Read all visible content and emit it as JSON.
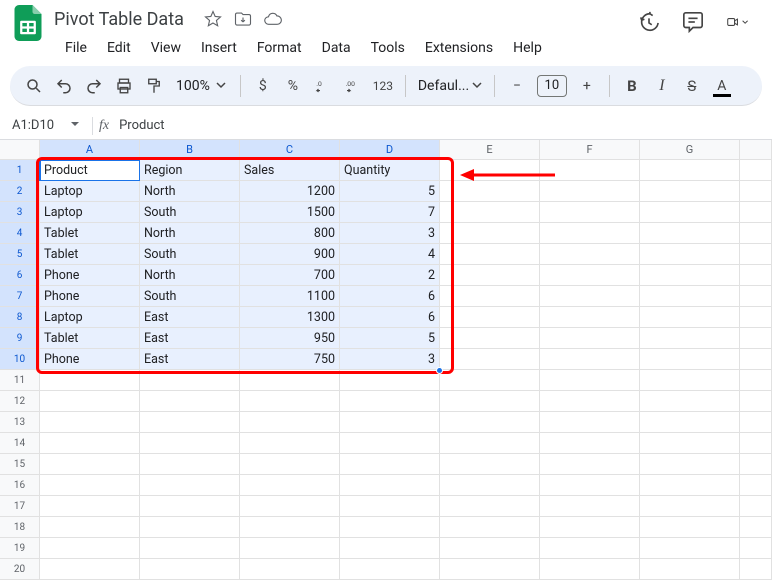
{
  "doc": {
    "title": "Pivot Table Data"
  },
  "menu": {
    "file": "File",
    "edit": "Edit",
    "view": "View",
    "insert": "Insert",
    "format": "Format",
    "data": "Data",
    "tools": "Tools",
    "extensions": "Extensions",
    "help": "Help"
  },
  "toolbar": {
    "zoom": "100%",
    "currency": "$",
    "percent": "%",
    "fmt123": "123",
    "font_name": "Defaul...",
    "minus": "−",
    "plus": "+",
    "font_size": "10",
    "bold": "B",
    "italic": "I",
    "strike": "S",
    "textcolor": "A"
  },
  "namebox": {
    "ref": "A1:D10"
  },
  "fx": {
    "label": "fx",
    "value": "Product"
  },
  "columns": [
    "A",
    "B",
    "C",
    "D",
    "E",
    "F",
    "G"
  ],
  "selected_cols": 4,
  "rows": [
    {
      "n": 1,
      "sel": true,
      "cells": [
        {
          "v": "Product",
          "active": true
        },
        {
          "v": "Region"
        },
        {
          "v": "Sales"
        },
        {
          "v": "Quantity"
        },
        {
          "v": ""
        },
        {
          "v": ""
        },
        {
          "v": ""
        }
      ]
    },
    {
      "n": 2,
      "sel": true,
      "cells": [
        {
          "v": "Laptop"
        },
        {
          "v": "North"
        },
        {
          "v": "1200",
          "num": true
        },
        {
          "v": "5",
          "num": true
        },
        {
          "v": ""
        },
        {
          "v": ""
        },
        {
          "v": ""
        }
      ]
    },
    {
      "n": 3,
      "sel": true,
      "cells": [
        {
          "v": "Laptop"
        },
        {
          "v": "South"
        },
        {
          "v": "1500",
          "num": true
        },
        {
          "v": "7",
          "num": true
        },
        {
          "v": ""
        },
        {
          "v": ""
        },
        {
          "v": ""
        }
      ]
    },
    {
      "n": 4,
      "sel": true,
      "cells": [
        {
          "v": "Tablet"
        },
        {
          "v": "North"
        },
        {
          "v": "800",
          "num": true
        },
        {
          "v": "3",
          "num": true
        },
        {
          "v": ""
        },
        {
          "v": ""
        },
        {
          "v": ""
        }
      ]
    },
    {
      "n": 5,
      "sel": true,
      "cells": [
        {
          "v": "Tablet"
        },
        {
          "v": "South"
        },
        {
          "v": "900",
          "num": true
        },
        {
          "v": "4",
          "num": true
        },
        {
          "v": ""
        },
        {
          "v": ""
        },
        {
          "v": ""
        }
      ]
    },
    {
      "n": 6,
      "sel": true,
      "cells": [
        {
          "v": "Phone"
        },
        {
          "v": "North"
        },
        {
          "v": "700",
          "num": true
        },
        {
          "v": "2",
          "num": true
        },
        {
          "v": ""
        },
        {
          "v": ""
        },
        {
          "v": ""
        }
      ]
    },
    {
      "n": 7,
      "sel": true,
      "cells": [
        {
          "v": "Phone"
        },
        {
          "v": "South"
        },
        {
          "v": "1100",
          "num": true
        },
        {
          "v": "6",
          "num": true
        },
        {
          "v": ""
        },
        {
          "v": ""
        },
        {
          "v": ""
        }
      ]
    },
    {
      "n": 8,
      "sel": true,
      "cells": [
        {
          "v": "Laptop"
        },
        {
          "v": "East"
        },
        {
          "v": "1300",
          "num": true
        },
        {
          "v": "6",
          "num": true
        },
        {
          "v": ""
        },
        {
          "v": ""
        },
        {
          "v": ""
        }
      ]
    },
    {
      "n": 9,
      "sel": true,
      "cells": [
        {
          "v": "Tablet"
        },
        {
          "v": "East"
        },
        {
          "v": "950",
          "num": true
        },
        {
          "v": "5",
          "num": true
        },
        {
          "v": ""
        },
        {
          "v": ""
        },
        {
          "v": ""
        }
      ]
    },
    {
      "n": 10,
      "sel": true,
      "cells": [
        {
          "v": "Phone"
        },
        {
          "v": "East"
        },
        {
          "v": "750",
          "num": true
        },
        {
          "v": "3",
          "num": true
        },
        {
          "v": ""
        },
        {
          "v": ""
        },
        {
          "v": ""
        }
      ]
    },
    {
      "n": 11,
      "cells": [
        {
          "v": ""
        },
        {
          "v": ""
        },
        {
          "v": ""
        },
        {
          "v": ""
        },
        {
          "v": ""
        },
        {
          "v": ""
        },
        {
          "v": ""
        }
      ]
    },
    {
      "n": 12,
      "cells": [
        {
          "v": ""
        },
        {
          "v": ""
        },
        {
          "v": ""
        },
        {
          "v": ""
        },
        {
          "v": ""
        },
        {
          "v": ""
        },
        {
          "v": ""
        }
      ]
    },
    {
      "n": 13,
      "cells": [
        {
          "v": ""
        },
        {
          "v": ""
        },
        {
          "v": ""
        },
        {
          "v": ""
        },
        {
          "v": ""
        },
        {
          "v": ""
        },
        {
          "v": ""
        }
      ]
    },
    {
      "n": 14,
      "cells": [
        {
          "v": ""
        },
        {
          "v": ""
        },
        {
          "v": ""
        },
        {
          "v": ""
        },
        {
          "v": ""
        },
        {
          "v": ""
        },
        {
          "v": ""
        }
      ]
    },
    {
      "n": 15,
      "cells": [
        {
          "v": ""
        },
        {
          "v": ""
        },
        {
          "v": ""
        },
        {
          "v": ""
        },
        {
          "v": ""
        },
        {
          "v": ""
        },
        {
          "v": ""
        }
      ]
    },
    {
      "n": 16,
      "cells": [
        {
          "v": ""
        },
        {
          "v": ""
        },
        {
          "v": ""
        },
        {
          "v": ""
        },
        {
          "v": ""
        },
        {
          "v": ""
        },
        {
          "v": ""
        }
      ]
    },
    {
      "n": 17,
      "cells": [
        {
          "v": ""
        },
        {
          "v": ""
        },
        {
          "v": ""
        },
        {
          "v": ""
        },
        {
          "v": ""
        },
        {
          "v": ""
        },
        {
          "v": ""
        }
      ]
    },
    {
      "n": 18,
      "cells": [
        {
          "v": ""
        },
        {
          "v": ""
        },
        {
          "v": ""
        },
        {
          "v": ""
        },
        {
          "v": ""
        },
        {
          "v": ""
        },
        {
          "v": ""
        }
      ]
    },
    {
      "n": 19,
      "cells": [
        {
          "v": ""
        },
        {
          "v": ""
        },
        {
          "v": ""
        },
        {
          "v": ""
        },
        {
          "v": ""
        },
        {
          "v": ""
        },
        {
          "v": ""
        }
      ]
    },
    {
      "n": 20,
      "cells": [
        {
          "v": ""
        },
        {
          "v": ""
        },
        {
          "v": ""
        },
        {
          "v": ""
        },
        {
          "v": ""
        },
        {
          "v": ""
        },
        {
          "v": ""
        }
      ]
    }
  ],
  "chart_data": {
    "type": "table",
    "columns": [
      "Product",
      "Region",
      "Sales",
      "Quantity"
    ],
    "rows": [
      [
        "Laptop",
        "North",
        1200,
        5
      ],
      [
        "Laptop",
        "South",
        1500,
        7
      ],
      [
        "Tablet",
        "North",
        800,
        3
      ],
      [
        "Tablet",
        "South",
        900,
        4
      ],
      [
        "Phone",
        "North",
        700,
        2
      ],
      [
        "Phone",
        "South",
        1100,
        6
      ],
      [
        "Laptop",
        "East",
        1300,
        6
      ],
      [
        "Tablet",
        "East",
        950,
        5
      ],
      [
        "Phone",
        "East",
        750,
        3
      ]
    ]
  }
}
